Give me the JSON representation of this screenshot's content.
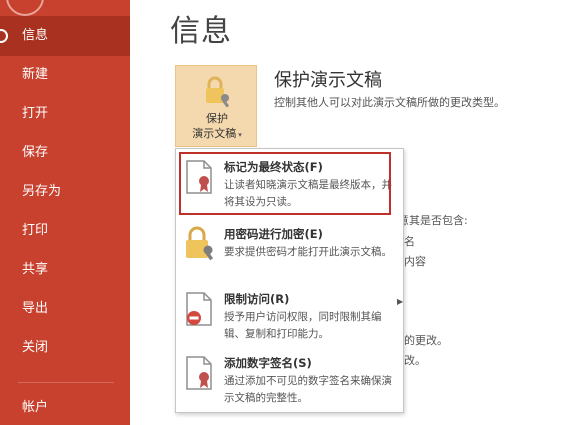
{
  "sidebar": {
    "items": [
      {
        "label": "信息"
      },
      {
        "label": "新建"
      },
      {
        "label": "打开"
      },
      {
        "label": "保存"
      },
      {
        "label": "另存为"
      },
      {
        "label": "打印"
      },
      {
        "label": "共享"
      },
      {
        "label": "导出"
      },
      {
        "label": "关闭"
      },
      {
        "label": "帐户"
      }
    ]
  },
  "page": {
    "title": "信息"
  },
  "protect": {
    "button_line1": "保护",
    "button_line2": "演示文稿",
    "title": "保护演示文稿",
    "description": "控制其他人可以对此演示文稿所做的更改类型。"
  },
  "background": {
    "t1": "意其是否包含:",
    "t2": "名",
    "t3": "内容",
    "t4": "的更改。",
    "t5": "改。"
  },
  "menu": {
    "items": [
      {
        "title": "标记为最终状态(F)",
        "desc": "让读者知晓演示文稿是最终版本，并将其设为只读。"
      },
      {
        "title": "用密码进行加密(E)",
        "desc": "要求提供密码才能打开此演示文稿。"
      },
      {
        "title": "限制访问(R)",
        "desc": "授予用户访问权限，同时限制其编辑、复制和打印能力。"
      },
      {
        "title": "添加数字签名(S)",
        "desc": "通过添加不可见的数字签名来确保演示文稿的完整性。"
      }
    ]
  },
  "colors": {
    "sidebar": "#c8412e",
    "sidebar_active": "#a8321f",
    "protect_button": "#f4d9ae",
    "highlight": "#c0302a"
  }
}
